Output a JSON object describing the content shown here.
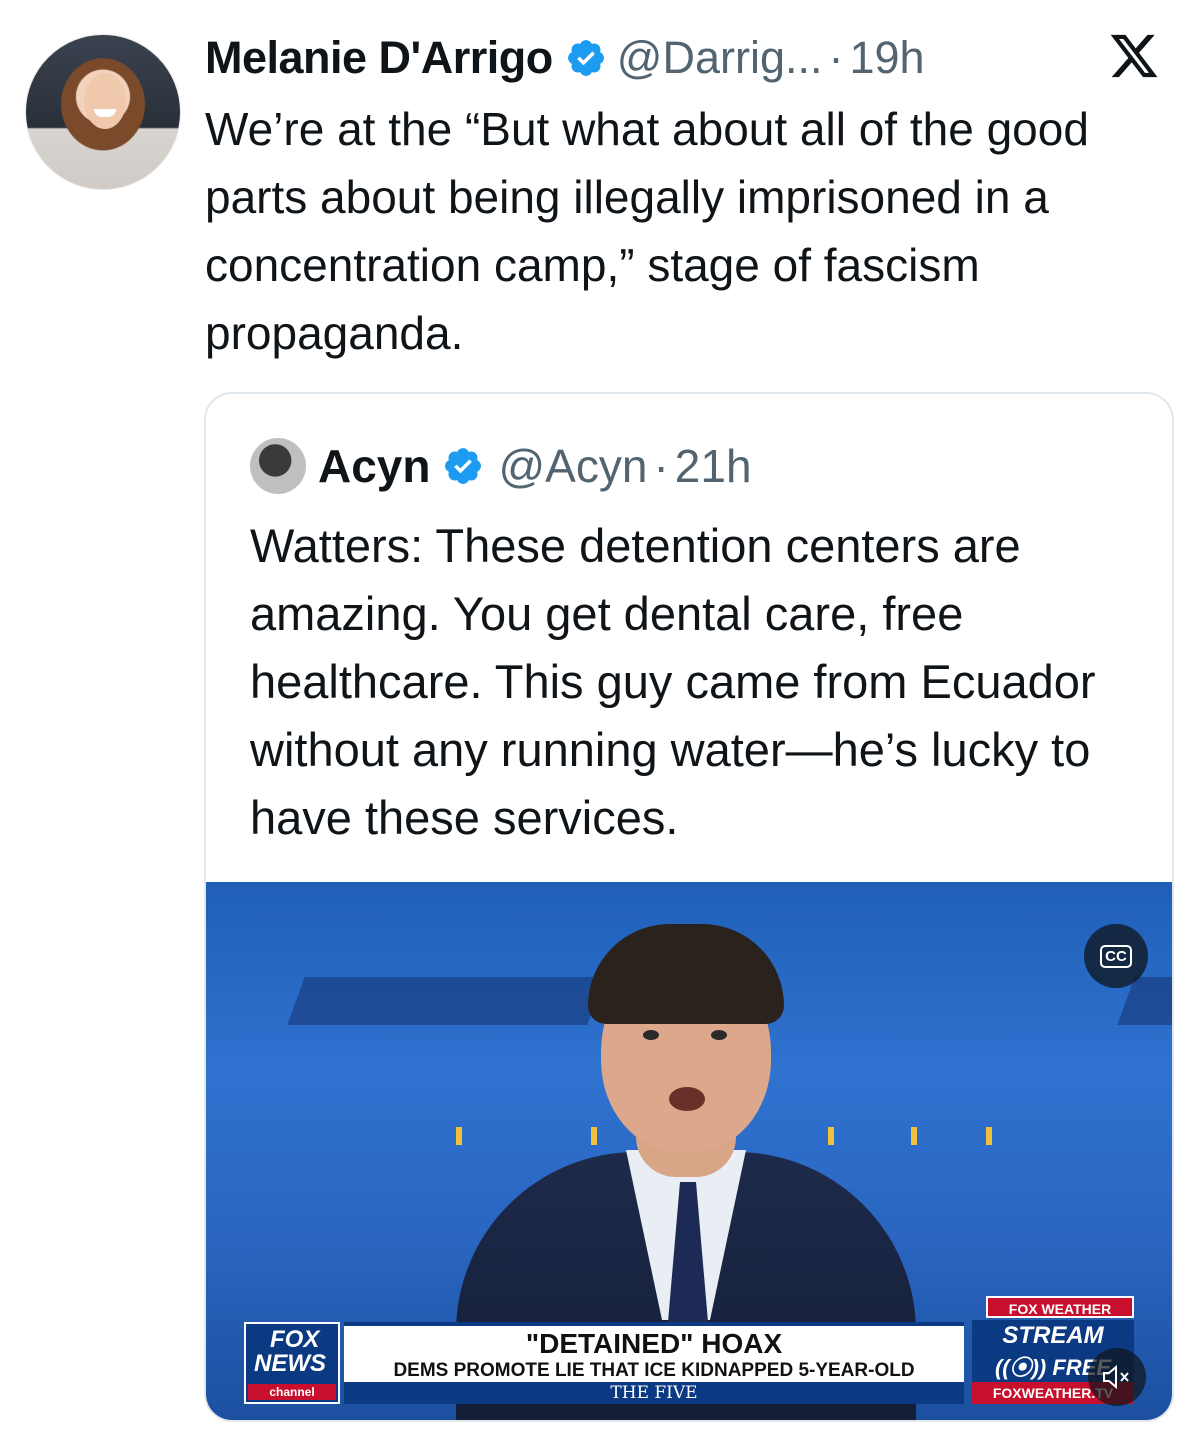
{
  "tweet": {
    "author_name": "Melanie D'Arrigo",
    "handle": "@Darrig...",
    "separator": "·",
    "time": "19h",
    "text": "We’re at the “But what about all of the good parts about being illegally imprisoned in a concentration camp,” stage of fascism propaganda."
  },
  "quote": {
    "author_name": "Acyn",
    "handle": "@Acyn",
    "separator": "·",
    "time": "21h",
    "text": "Watters: These detention centers are amazing. You get dental care, free healthcare. This guy came from Ecuador without any running water—he’s lucky to have these services."
  },
  "video": {
    "cc_label": "CC",
    "network_logo": {
      "line1": "FOX",
      "line2": "NEWS",
      "line3": "channel"
    },
    "headline": "\"DETAINED\" HOAX",
    "subheadline": "DEMS PROMOTE LIE THAT ICE KIDNAPPED 5-YEAR-OLD",
    "show_name": "THE FIVE",
    "weather_promo": {
      "top": "FOX WEATHER",
      "line1": "STREAM",
      "line2": "((⦿)) FREE",
      "bottom": "FOXWEATHER.TV"
    }
  },
  "icons": [
    "verified-badge-icon",
    "x-logo-icon",
    "closed-captions-icon",
    "mute-icon"
  ],
  "colors": {
    "verified": "#1d9bf0",
    "secondary_text": "#536471",
    "fox_blue": "#0b3a82",
    "fox_red": "#c8102e"
  }
}
